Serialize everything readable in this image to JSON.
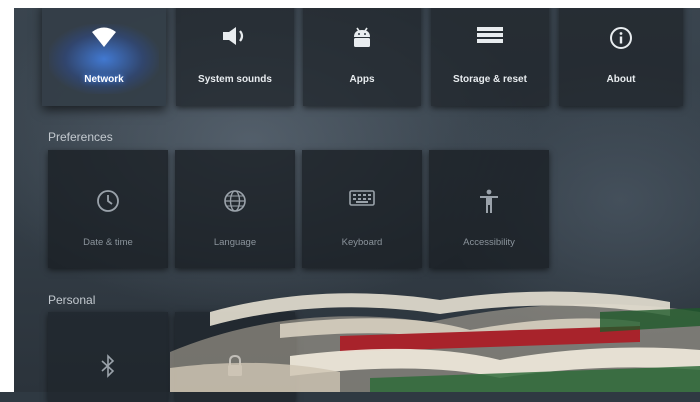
{
  "top_row": [
    {
      "label": "Network",
      "icon": "wifi-icon",
      "selected": true
    },
    {
      "label": "System sounds",
      "icon": "speaker-icon"
    },
    {
      "label": "Apps",
      "icon": "android-icon"
    },
    {
      "label": "Storage & reset",
      "icon": "storage-icon"
    },
    {
      "label": "About",
      "icon": "info-icon"
    }
  ],
  "preferences": {
    "header": "Preferences",
    "items": [
      {
        "label": "Date & time",
        "icon": "clock-icon"
      },
      {
        "label": "Language",
        "icon": "globe-icon"
      },
      {
        "label": "Keyboard",
        "icon": "keyboard-icon"
      },
      {
        "label": "Accessibility",
        "icon": "accessibility-icon"
      }
    ]
  },
  "personal": {
    "header": "Personal",
    "items": [
      {
        "label": "",
        "icon": "bluetooth-icon"
      },
      {
        "label": "",
        "icon": "lock-icon"
      }
    ]
  },
  "colors": {
    "accent_glow": "#468cff",
    "tile_bg": "#1e242a",
    "text": "#e8ecef",
    "dim_text": "#8b949c"
  }
}
